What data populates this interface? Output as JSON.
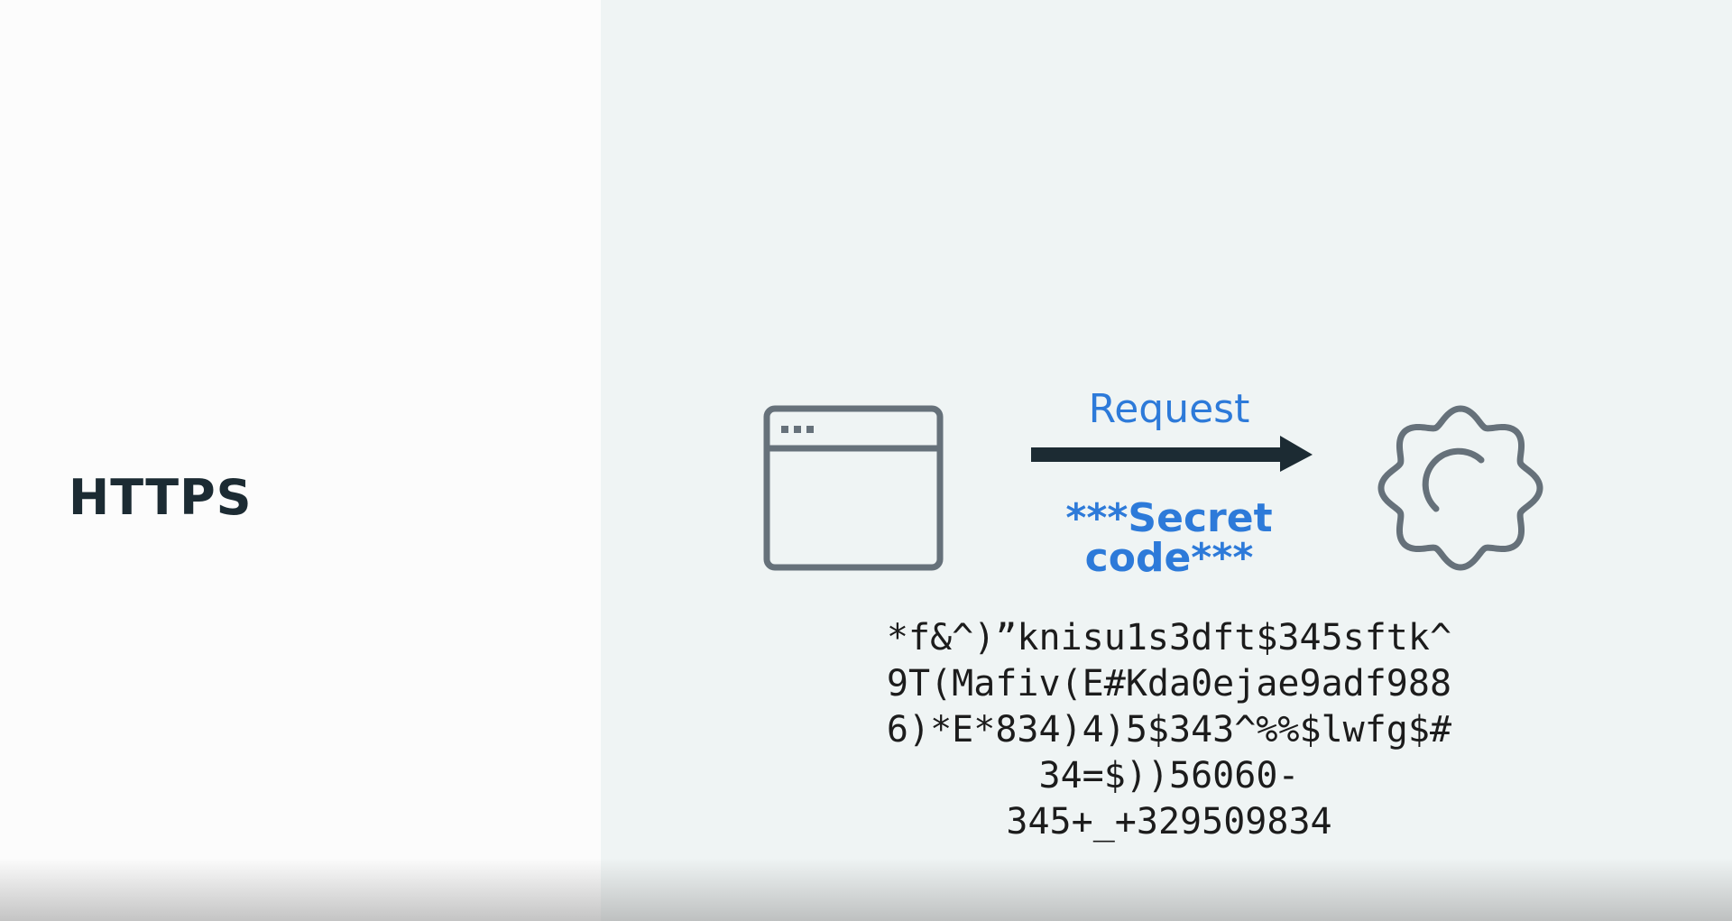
{
  "slide": {
    "title": "HTTPS",
    "request_label": "Request",
    "secret_label": "***Secret code***",
    "cipher_lines": [
      "*f&^)”knisu1s3dft$345sftk^",
      "9T(Mafiv(E#Kda0ejae9adf988",
      "6)*E*834)4)5$343^%%$lwfg$#",
      "34=$))56060-",
      "345+_+329509834"
    ]
  },
  "icons": {
    "browser": "browser-window-icon",
    "arrow": "arrow-right-icon",
    "server": "gear-icon"
  },
  "colors": {
    "accent_blue": "#2d7ad9",
    "title_dark": "#1c2b33",
    "icon_gray": "#66717a",
    "arrow_dark": "#1c2b33",
    "right_panel_bg": "#eff4f4",
    "left_panel_bg": "#fcfcfc"
  }
}
